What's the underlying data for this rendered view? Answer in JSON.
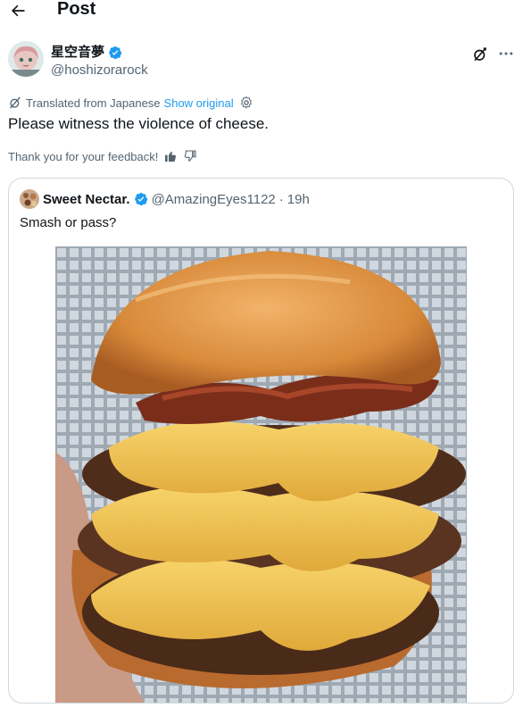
{
  "header": {
    "title": "Post",
    "back_icon": "arrow-left-icon"
  },
  "author": {
    "display_name": "星空音夢",
    "handle": "@hoshizorarock",
    "verified": true,
    "verified_color": "#1d9bf0"
  },
  "translation": {
    "label": "Translated from Japanese",
    "show_original": "Show original"
  },
  "tweet": {
    "text": "Please witness the violence of cheese."
  },
  "feedback": {
    "label": "Thank you for your feedback!"
  },
  "quote": {
    "display_name": "Sweet Nectar.",
    "handle": "@AmazingEyes1122",
    "separator": "·",
    "time": "19h",
    "text": "Smash or pass?",
    "verified": true
  },
  "colors": {
    "text_primary": "#0f1419",
    "text_secondary": "#536471",
    "link": "#1d9bf0",
    "border": "#cfd9de"
  }
}
